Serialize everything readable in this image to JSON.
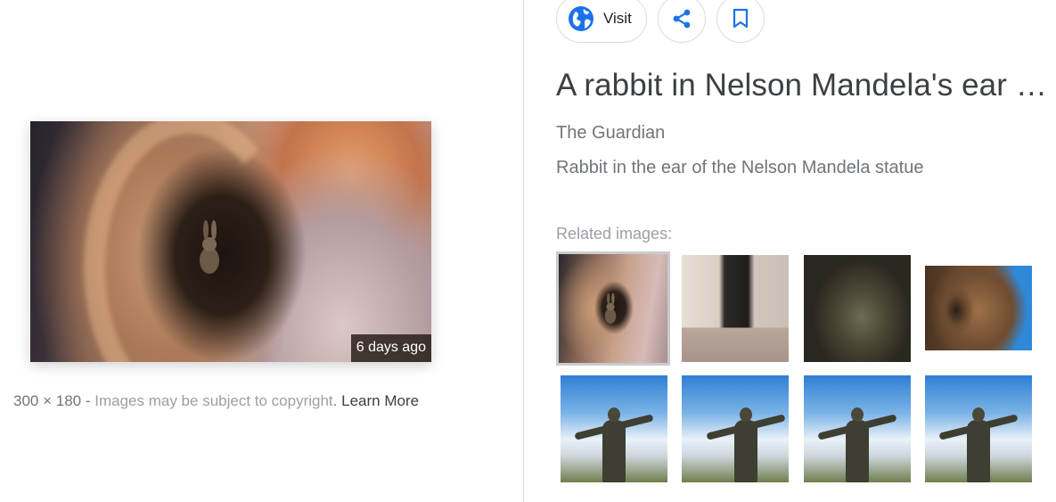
{
  "preview": {
    "badge": "6 days ago",
    "dimensions": "300 × 180",
    "separator": "-",
    "copyright_notice": "Images may be subject to copyright",
    "period": ".",
    "learn_more": "Learn More"
  },
  "actions": {
    "visit_label": "Visit",
    "visit_icon": "globe-icon",
    "share_icon": "share-icon",
    "save_icon": "bookmark-icon"
  },
  "result": {
    "title": "A rabbit in Nelson Mandela's ear …",
    "source": "The Guardian",
    "caption": "Rabbit in the ear of the Nelson Mandela statue"
  },
  "related": {
    "label": "Related images:",
    "thumbnails": [
      {
        "name": "related-image-1",
        "selected": true
      },
      {
        "name": "related-image-2",
        "selected": false
      },
      {
        "name": "related-image-3",
        "selected": false
      },
      {
        "name": "related-image-4",
        "selected": false
      },
      {
        "name": "related-image-5",
        "selected": false
      },
      {
        "name": "related-image-6",
        "selected": false
      },
      {
        "name": "related-image-7",
        "selected": false
      },
      {
        "name": "related-image-8",
        "selected": false
      }
    ]
  },
  "colors": {
    "accent_blue": "#1a73e8",
    "text_dark": "#3c4043",
    "text_muted": "#70757a"
  }
}
